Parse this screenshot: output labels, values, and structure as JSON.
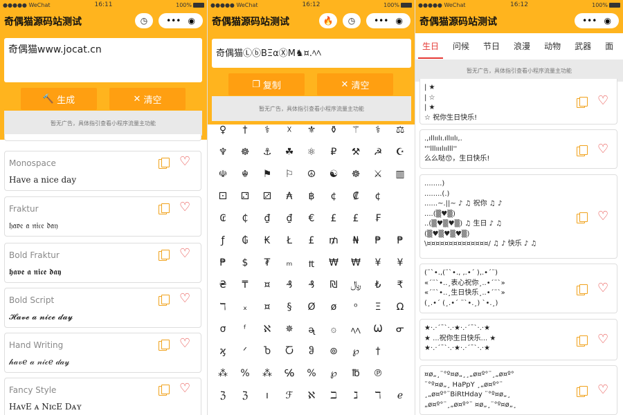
{
  "status": {
    "carrier": "●●●●● WeChat",
    "p1_time": "16:11",
    "p2_time": "16:12",
    "p3_time": "16:12",
    "battery": "100%"
  },
  "app": {
    "title": "奇偶猫源码站测试"
  },
  "p1": {
    "input": "奇偶猫www.jocat.cn",
    "generate": "生成",
    "clear": "清空",
    "ad": "暂无广告，具体指引查看小程序流量主功能",
    "styles": [
      {
        "name": "Monospace",
        "sample": "Have a nice day"
      },
      {
        "name": "Fraktur",
        "sample": "𝔥𝔞𝔳𝔢 𝔞 𝔫𝔦𝔠𝔢 𝔡𝔞𝔶"
      },
      {
        "name": "Bold Fraktur",
        "sample": "𝖍𝖆𝖛𝖊 𝖆 𝖓𝖎𝖈𝖊 𝖉𝖆𝖞"
      },
      {
        "name": "Bold Script",
        "sample": "𝓗𝓪𝓿𝓮 𝓪 𝓷𝓲𝓬𝓮 𝓭𝓪𝔂"
      },
      {
        "name": "Hand Writing",
        "sample": "𝒽𝒶𝓋𝑒 𝒶 𝓃𝒾𝒸𝑒 𝒹𝒶𝓎"
      },
      {
        "name": "Fancy Style",
        "sample": "HᴀᴠE ᴀ NɪᴄE Dᴀʏ"
      }
    ]
  },
  "p2": {
    "input": "奇偶猫ⓁⓑBΞαⓍM♞¤.ﾍﾍ",
    "copy": "复制",
    "clear": "清空",
    "ad": "暂无广告，具体指引查看小程序流量主功能",
    "symbols": [
      [
        "♀",
        "†",
        "⚕",
        "☓",
        "⚜",
        "⚱",
        "⚚",
        "⚕",
        "⚖"
      ],
      [
        "♆",
        "☸",
        "⚓",
        "☘",
        "⚛",
        "₽",
        "⚒",
        "☭",
        "☪"
      ],
      [
        "☫",
        "☬",
        "⚑",
        "⚐",
        "☮",
        "☯",
        "☸",
        "⚔",
        "▥"
      ],
      [
        "⚀",
        "⚁",
        "⚂",
        "₳",
        "฿",
        "¢",
        "₡",
        "¢"
      ],
      [
        "₢",
        "₵",
        "₫",
        "₫",
        "€",
        "£",
        "£",
        "₣"
      ],
      [
        "ƒ",
        "₲",
        "₭",
        "Ł",
        "£",
        "₥",
        "₦",
        "₱",
        "₱"
      ],
      [
        "₱",
        "$",
        "₮",
        "ₘ",
        "₶",
        "₩",
        "₩",
        "¥",
        "¥"
      ],
      [
        "₴",
        "₸",
        "¤",
        "₰",
        "₰",
        "₪",
        "﷼",
        "₺",
        "₹"
      ],
      [
        "ℸ",
        "ₓ",
        "¤",
        "§",
        "Ø",
        "ø",
        "ᵒ",
        "Ξ",
        "Ω"
      ],
      [
        "σ",
        "ᶠ",
        "ℵ",
        "✵",
        "ᶕ",
        "۞",
        "ﾍﾍ",
        "Ѡ",
        "ᓂ"
      ],
      [
        "ϗ",
        "ᐟ",
        "Ⴆ",
        "Ⴀ",
        "ჵ",
        "⊚",
        "℘",
        "†"
      ],
      [
        "⁂",
        "%",
        "⁂",
        "℅",
        "%",
        "℘",
        "℔",
        "℗"
      ],
      [
        "ℨ",
        "ℨ",
        "ı",
        "ℱ",
        "ℵ",
        "ℶ",
        "ℷ",
        "ℸ",
        "ℯ"
      ]
    ]
  },
  "p3": {
    "tabs": [
      "生日",
      "问候",
      "节日",
      "浪漫",
      "动物",
      "武器",
      "面"
    ],
    "ad": "暂无广告，具体指引查看小程序流量主功能",
    "cards": [
      [
        "|   ★",
        "|      ☆",
        "|      ★",
        "☆ 祝你生日快乐!"
      ],
      [
        ".,ıllıılı.ıllıılı,.",
        "'''lllııılıılll''",
        "么么哒😙，生日快乐!"
      ],
      [
        "........)",
        "........(.)",
        "......~.||~ ♪ ♫ 祝你 ♫ ♪",
        "....(▒♥▒)",
        "..(▒♥▒♥▒) ♫ 生日 ♪ ♫",
        "(▒♥▒♥▒♥▒)",
        "\\¤¤¤¤¤¤¤¤¤¤¤¤¤¤/ ♫ ♪ 快乐 ♪ ♫"
      ],
      [
        "(¨`•.,(¨`•.,  ,.•´  ),.•´¨)",
        "«´¨`•..¸表心祝你¸..•´¨`»",
        "«´¨`•..¸生日快乐¸..•´¨`»",
        "(¸.•´ (¸.•´ ¨`•.¸) `•.¸)"
      ],
      [
        "★·.·´¯`·.·★·.·´¯`·.·★",
        "★ ...祝你生日快乐... ★",
        "★·.·´¯`·.·★·.·´¯`·.·★"
      ],
      [
        "¤ø„¸¨°º¤ø„¸¸„ø¤º°¨¸„ø¤º°",
        "¨°º¤ø„¸ HaPpY ¸„ø¤º°¨",
        "¸„ø¤º°¨BiRtHday ¨°º¤ø„¸",
        "„ø¤º°¨¸„ø¤º°¨ ¤ø„¸¨°º¤ø„¸"
      ]
    ]
  }
}
